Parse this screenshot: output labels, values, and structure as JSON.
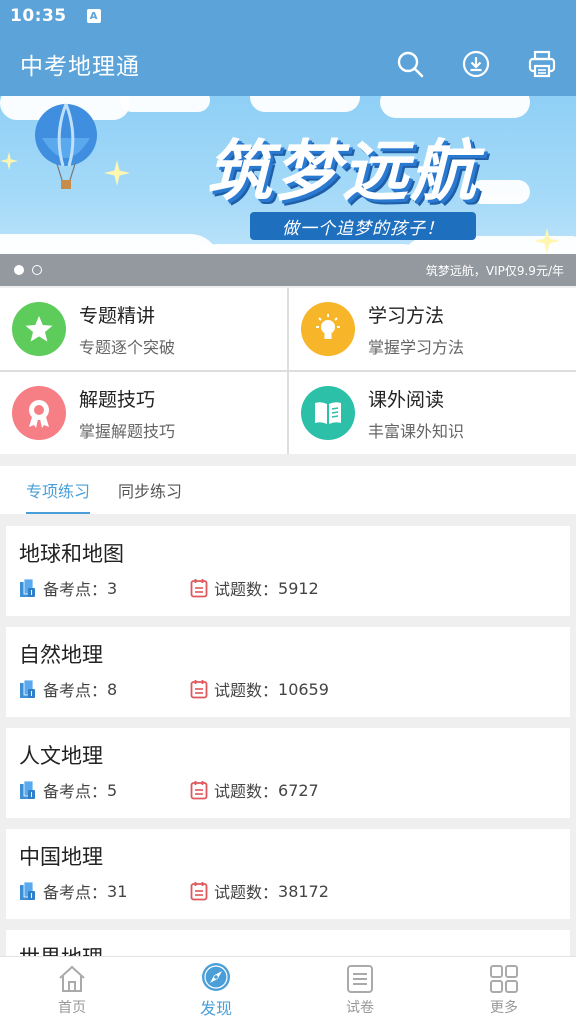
{
  "status_bar": {
    "time": "10:35",
    "notification_icon": "A"
  },
  "app_bar": {
    "title": "中考地理通",
    "icons": [
      "search-icon",
      "download-icon",
      "print-icon"
    ]
  },
  "banner": {
    "headline": "筑梦远航",
    "slogan": "做一个追梦的孩子！",
    "caption": "筑梦远航，VIP仅9.9元/年",
    "page_count": 2,
    "active_page": 1
  },
  "features": [
    {
      "title": "专题精讲",
      "subtitle": "专题逐个突破",
      "icon": "star-icon",
      "color": "#5dcc5b"
    },
    {
      "title": "学习方法",
      "subtitle": "掌握学习方法",
      "icon": "lightbulb-icon",
      "color": "#f7b62a"
    },
    {
      "title": "解题技巧",
      "subtitle": "掌握解题技巧",
      "icon": "badge-icon",
      "color": "#f57f85"
    },
    {
      "title": "课外阅读",
      "subtitle": "丰富课外知识",
      "icon": "book-icon",
      "color": "#2cc0a9"
    }
  ],
  "tabs": [
    {
      "label": "专项练习",
      "active": true
    },
    {
      "label": "同步练习",
      "active": false
    }
  ],
  "list_labels": {
    "points": "备考点：",
    "questions": "试题数："
  },
  "items": [
    {
      "name": "地球和地图",
      "points": "3",
      "questions": "5912"
    },
    {
      "name": "自然地理",
      "points": "8",
      "questions": "10659"
    },
    {
      "name": "人文地理",
      "points": "5",
      "questions": "6727"
    },
    {
      "name": "中国地理",
      "points": "31",
      "questions": "38172"
    },
    {
      "name": "世界地理",
      "points": "",
      "questions": ""
    }
  ],
  "bottom_nav": [
    {
      "label": "首页",
      "icon": "home-icon",
      "active": false
    },
    {
      "label": "发现",
      "icon": "compass-icon",
      "active": true
    },
    {
      "label": "试卷",
      "icon": "paper-icon",
      "active": false
    },
    {
      "label": "更多",
      "icon": "grid-icon",
      "active": false
    }
  ],
  "colors": {
    "primary": "#5ba3d9",
    "accent": "#4a9fd8"
  }
}
